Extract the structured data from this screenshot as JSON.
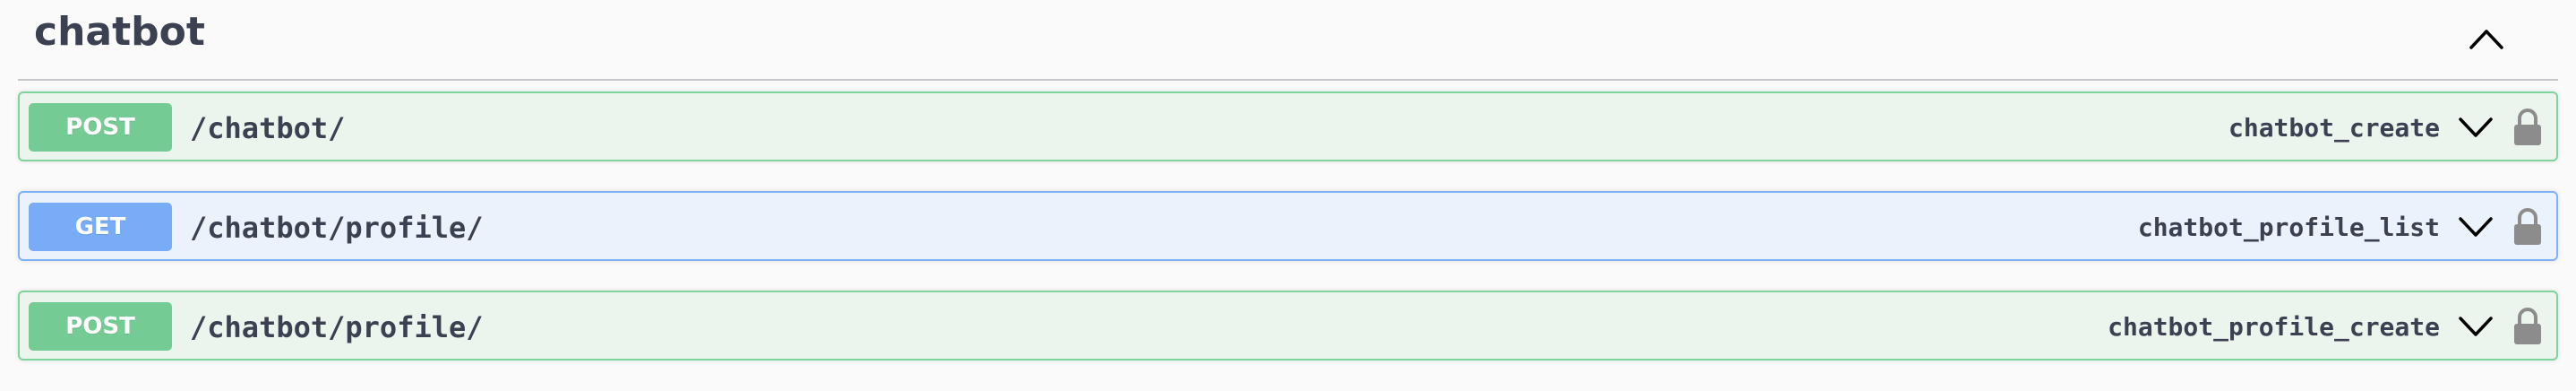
{
  "section": {
    "title": "chatbot",
    "collapse_icon": "chevron-up-icon"
  },
  "operations": [
    {
      "method": "POST",
      "path": "/chatbot/",
      "operation_id": "chatbot_create",
      "expand_icon": "chevron-down-icon",
      "auth_icon": "lock-icon",
      "color": "#74cc94"
    },
    {
      "method": "GET",
      "path": "/chatbot/profile/",
      "operation_id": "chatbot_profile_list",
      "expand_icon": "chevron-down-icon",
      "auth_icon": "lock-icon",
      "color": "#78acf7"
    },
    {
      "method": "POST",
      "path": "/chatbot/profile/",
      "operation_id": "chatbot_profile_create",
      "expand_icon": "chevron-down-icon",
      "auth_icon": "lock-icon",
      "color": "#74cc94"
    }
  ]
}
